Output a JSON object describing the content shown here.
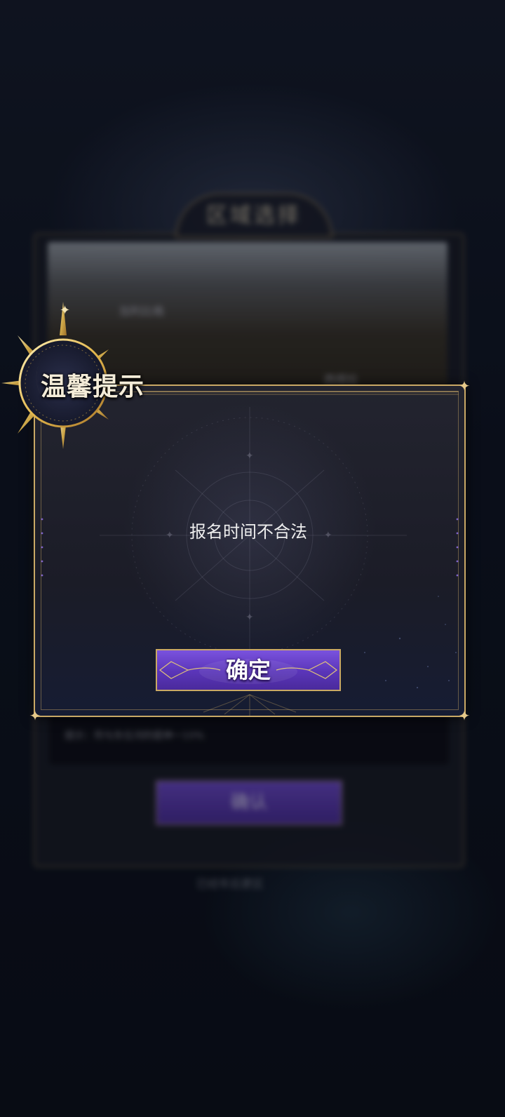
{
  "background": {
    "panel_title": "区域选择",
    "map_label_1": "加利比格",
    "map_label_2": "西塔拉",
    "info_text": "提示：符与东位河的提神一10%",
    "confirm_label": "确认",
    "footer_text": "已经年后更区"
  },
  "dialog": {
    "title": "温馨提示",
    "message": "报名时间不合法",
    "confirm_label": "确定"
  },
  "colors": {
    "gold": "#c9a865",
    "button_purple": "#6a45cc",
    "panel_bg": "#1b1c27"
  }
}
